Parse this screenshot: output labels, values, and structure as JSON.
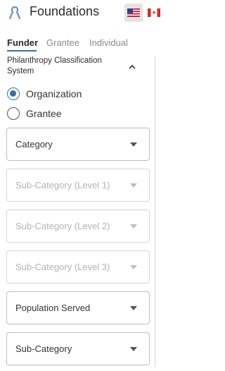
{
  "header": {
    "title": "Foundations",
    "logo_icon": "ribbon-icon",
    "flags": [
      "us-flag-icon",
      "canada-flag-icon"
    ]
  },
  "tabs": [
    {
      "label": "Funder",
      "active": true
    },
    {
      "label": "Grantee",
      "active": false
    },
    {
      "label": "Individual",
      "active": false
    }
  ],
  "section": {
    "title": "Philanthropy Classification System",
    "collapse_icon": "chevron-up-icon"
  },
  "radios": [
    {
      "label": "Organization",
      "checked": true
    },
    {
      "label": "Grantee",
      "checked": false
    }
  ],
  "selects": [
    {
      "value": "Category",
      "disabled": false
    },
    {
      "value": "Sub-Category (Level 1)",
      "disabled": true
    },
    {
      "value": "Sub-Category (Level 2)",
      "disabled": true
    },
    {
      "value": "Sub-Category (Level 3)",
      "disabled": true
    },
    {
      "value": "Population Served",
      "disabled": false
    },
    {
      "value": "Sub-Category",
      "disabled": false
    }
  ],
  "colors": {
    "accent": "#3a6ea5",
    "text": "#333333",
    "disabled_text": "#b3b3b3"
  }
}
